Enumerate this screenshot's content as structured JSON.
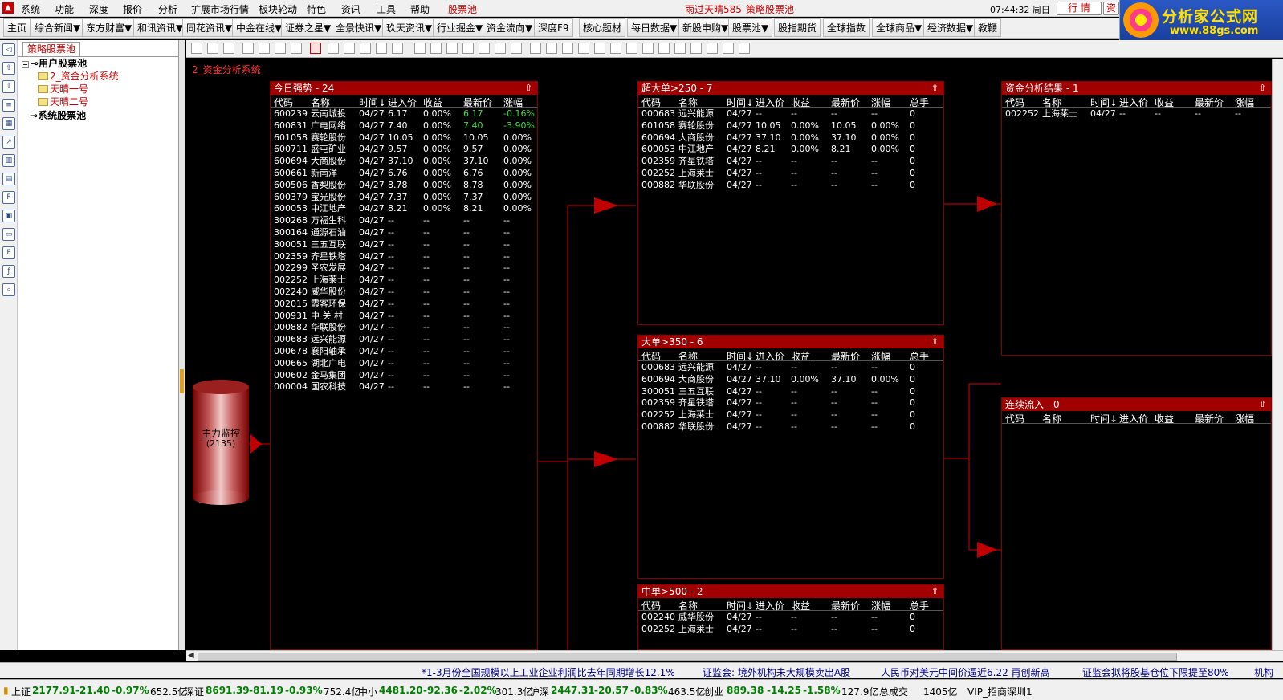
{
  "menubar": {
    "items": [
      "系统",
      "功能",
      "深度",
      "报价",
      "分析",
      "扩展市场行情",
      "板块轮动",
      "特色",
      "资讯",
      "工具",
      "帮助"
    ],
    "active_tab": "股票池",
    "weather": "雨过天晴585",
    "pool_title": "策略股票池",
    "clock": "07:44:32 周日",
    "btn_quote": "行 情",
    "btn_info": "资"
  },
  "brand": {
    "title": "分析家公式网",
    "url": "www.88gs.com"
  },
  "navbar": {
    "items": [
      "主页",
      "综合新闻▼",
      "东方财富▼",
      "和讯资讯▼",
      "同花资讯▼",
      "中金在线▼",
      "证券之星▼",
      "全景快讯▼",
      "玖天资讯▼",
      "行业掘金▼",
      "资金流向▼",
      "深度F9",
      "核心题材",
      "每日数据▼",
      "新股申购▼",
      "股票池▼",
      "股指期货",
      "全球指数",
      "全球商品▼",
      "经济数据▼",
      "教鞭"
    ]
  },
  "tree": {
    "tab": "策略股票池",
    "user_pool": "用户股票池",
    "items": [
      "2_资金分析系统",
      "天晴一号",
      "天晴二号"
    ],
    "system_pool": "系统股票池"
  },
  "canvas": {
    "title": "2_资金分析系统"
  },
  "cylinder": {
    "label": "主力监控",
    "count": "(2135)"
  },
  "columns": [
    "代码",
    "名称",
    "时间↓",
    "进入价",
    "收益",
    "最新价",
    "涨幅",
    "总手"
  ],
  "panels": {
    "today": {
      "title": "今日强势 - 24",
      "rows": [
        [
          "600239",
          "云南城投",
          "04/27",
          "6.17",
          "0.00%",
          "6.17",
          "-0.16%"
        ],
        [
          "600831",
          "广电网络",
          "04/27",
          "7.40",
          "0.00%",
          "7.40",
          "-3.90%"
        ],
        [
          "601058",
          "赛轮股份",
          "04/27",
          "10.05",
          "0.00%",
          "10.05",
          "0.00%"
        ],
        [
          "600711",
          "盛屯矿业",
          "04/27",
          "9.57",
          "0.00%",
          "9.57",
          "0.00%"
        ],
        [
          "600694",
          "大商股份",
          "04/27",
          "37.10",
          "0.00%",
          "37.10",
          "0.00%"
        ],
        [
          "600661",
          "新南洋",
          "04/27",
          "6.76",
          "0.00%",
          "6.76",
          "0.00%"
        ],
        [
          "600506",
          "香梨股份",
          "04/27",
          "8.78",
          "0.00%",
          "8.78",
          "0.00%"
        ],
        [
          "600379",
          "宝光股份",
          "04/27",
          "7.37",
          "0.00%",
          "7.37",
          "0.00%"
        ],
        [
          "600053",
          "中江地产",
          "04/27",
          "8.21",
          "0.00%",
          "8.21",
          "0.00%"
        ],
        [
          "300268",
          "万福生科",
          "04/27",
          "--",
          "--",
          "--",
          "--"
        ],
        [
          "300164",
          "通源石油",
          "04/27",
          "--",
          "--",
          "--",
          "--"
        ],
        [
          "300051",
          "三五互联",
          "04/27",
          "--",
          "--",
          "--",
          "--"
        ],
        [
          "002359",
          "齐星铁塔",
          "04/27",
          "--",
          "--",
          "--",
          "--"
        ],
        [
          "002299",
          "圣农发展",
          "04/27",
          "--",
          "--",
          "--",
          "--"
        ],
        [
          "002252",
          "上海莱士",
          "04/27",
          "--",
          "--",
          "--",
          "--"
        ],
        [
          "002240",
          "威华股份",
          "04/27",
          "--",
          "--",
          "--",
          "--"
        ],
        [
          "002015",
          "霞客环保",
          "04/27",
          "--",
          "--",
          "--",
          "--"
        ],
        [
          "000931",
          "中 关 村",
          "04/27",
          "--",
          "--",
          "--",
          "--"
        ],
        [
          "000882",
          "华联股份",
          "04/27",
          "--",
          "--",
          "--",
          "--"
        ],
        [
          "000683",
          "远兴能源",
          "04/27",
          "--",
          "--",
          "--",
          "--"
        ],
        [
          "000678",
          "襄阳轴承",
          "04/27",
          "--",
          "--",
          "--",
          "--"
        ],
        [
          "000665",
          "湖北广电",
          "04/27",
          "--",
          "--",
          "--",
          "--"
        ],
        [
          "000602",
          "金马集团",
          "04/27",
          "--",
          "--",
          "--",
          "--"
        ],
        [
          "000004",
          "国农科技",
          "04/27",
          "--",
          "--",
          "--",
          "--"
        ]
      ]
    },
    "super": {
      "title": "超大单>250 - 7",
      "rows": [
        [
          "000683",
          "远兴能源",
          "04/27",
          "--",
          "--",
          "--",
          "--",
          "0"
        ],
        [
          "601058",
          "赛轮股份",
          "04/27",
          "10.05",
          "0.00%",
          "10.05",
          "0.00%",
          "0"
        ],
        [
          "600694",
          "大商股份",
          "04/27",
          "37.10",
          "0.00%",
          "37.10",
          "0.00%",
          "0"
        ],
        [
          "600053",
          "中江地产",
          "04/27",
          "8.21",
          "0.00%",
          "8.21",
          "0.00%",
          "0"
        ],
        [
          "002359",
          "齐星铁塔",
          "04/27",
          "--",
          "--",
          "--",
          "--",
          "0"
        ],
        [
          "002252",
          "上海莱士",
          "04/27",
          "--",
          "--",
          "--",
          "--",
          "0"
        ],
        [
          "000882",
          "华联股份",
          "04/27",
          "--",
          "--",
          "--",
          "--",
          "0"
        ]
      ]
    },
    "big": {
      "title": "大单>350 - 6",
      "rows": [
        [
          "000683",
          "远兴能源",
          "04/27",
          "--",
          "--",
          "--",
          "--",
          "0"
        ],
        [
          "600694",
          "大商股份",
          "04/27",
          "37.10",
          "0.00%",
          "37.10",
          "0.00%",
          "0"
        ],
        [
          "300051",
          "三五互联",
          "04/27",
          "--",
          "--",
          "--",
          "--",
          "0"
        ],
        [
          "002359",
          "齐星铁塔",
          "04/27",
          "--",
          "--",
          "--",
          "--",
          "0"
        ],
        [
          "002252",
          "上海莱士",
          "04/27",
          "--",
          "--",
          "--",
          "--",
          "0"
        ],
        [
          "000882",
          "华联股份",
          "04/27",
          "--",
          "--",
          "--",
          "--",
          "0"
        ]
      ]
    },
    "mid": {
      "title": "中单>500 - 2",
      "rows": [
        [
          "002240",
          "威华股份",
          "04/27",
          "--",
          "--",
          "--",
          "--",
          "0"
        ],
        [
          "002252",
          "上海莱士",
          "04/27",
          "--",
          "--",
          "--",
          "--",
          "0"
        ]
      ]
    },
    "result": {
      "title": "资金分析结果 - 1",
      "rows": [
        [
          "002252",
          "上海莱士",
          "04/27",
          "--",
          "--",
          "--",
          "--"
        ]
      ]
    },
    "inflow": {
      "title": "连续流入 - 0",
      "rows": []
    }
  },
  "ticker": [
    "*1-3月份全国规模以上工业企业利润比去年同期增长12.1%",
    "证监会: 境外机构未大规模卖出A股",
    "人民币对美元中间价逼近6.22 再创新高",
    "证监会拟将股基仓位下限提至80%",
    "机构"
  ],
  "status": {
    "sh": {
      "name": "上证",
      "val": "2177.91",
      "chg": "-21.40",
      "pct": "-0.97%",
      "amt": "652.5亿"
    },
    "sz": {
      "name": "深证",
      "val": "8691.39",
      "chg": "-81.19",
      "pct": "-0.93%",
      "amt": "752.4亿"
    },
    "zx": {
      "name": "中小",
      "val": "4481.20",
      "chg": "-92.36",
      "pct": "-2.02%",
      "amt": "301.3亿"
    },
    "hs": {
      "name": "沪深",
      "val": "2447.31",
      "chg": "-20.57",
      "pct": "-0.83%",
      "amt": "463.5亿"
    },
    "cy": {
      "name": "创业",
      "val": "889.38",
      "chg": "-14.25",
      "pct": "-1.58%",
      "amt": "127.9亿"
    },
    "deal_label": "总成交",
    "deal": "1405亿",
    "vip": "VIP_招商深圳1"
  }
}
